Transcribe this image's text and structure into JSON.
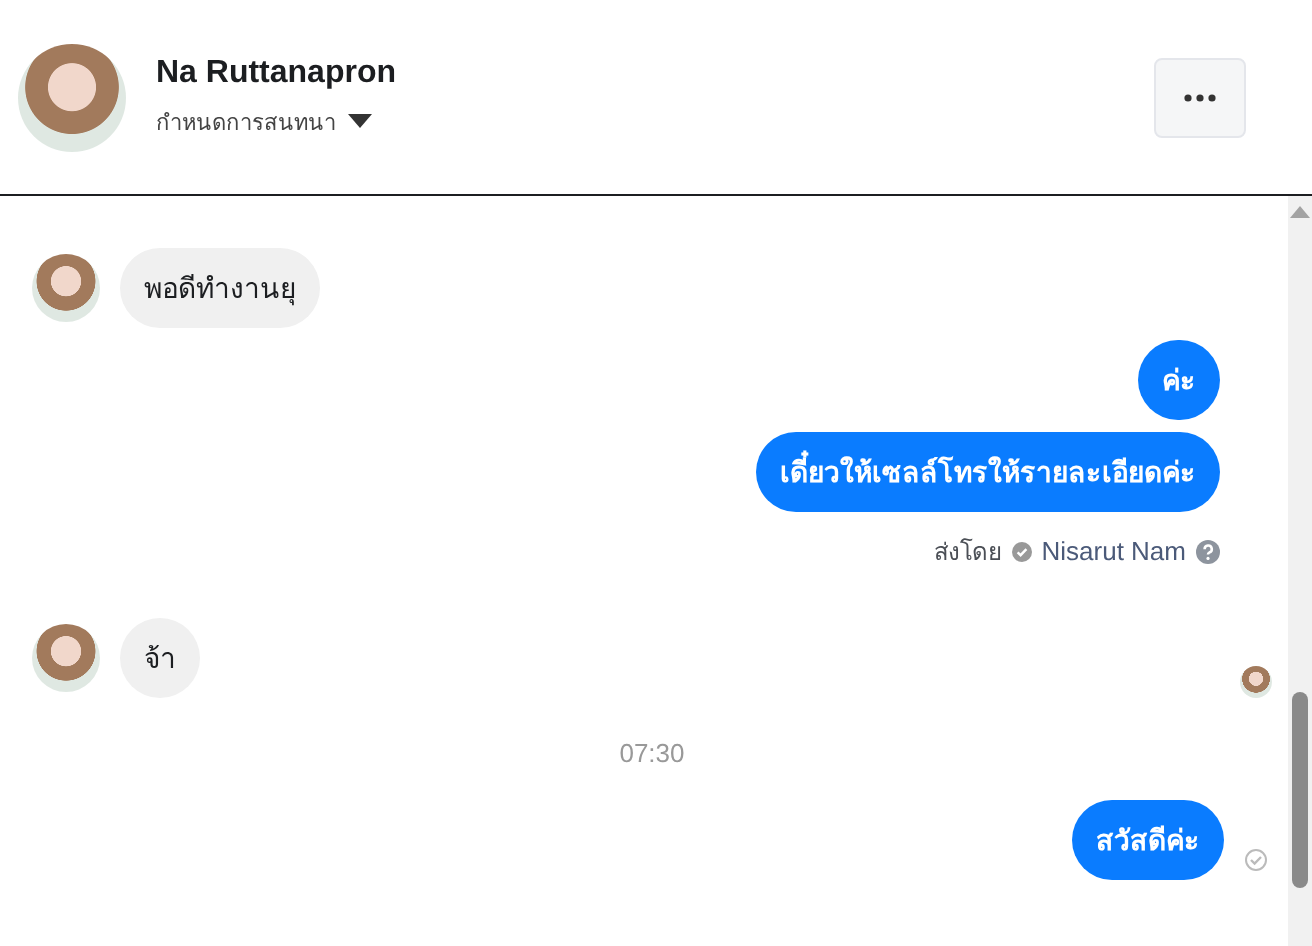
{
  "header": {
    "name": "Na Ruttanapron",
    "subtitle": "กำหนดการสนทนา"
  },
  "messages": [
    {
      "kind": "incoming",
      "text": "พอดีทำงานยุ",
      "avatar": true,
      "read_avatar": false
    },
    {
      "kind": "outgoing",
      "text": "ค่ะ",
      "delivered": false
    },
    {
      "kind": "outgoing",
      "text": "เดี๋ยวให้เซลล์โทรให้รายละเอียดค่ะ",
      "delivered": false
    },
    {
      "kind": "sent_by",
      "label": "ส่งโดย",
      "name": "Nisarut Nam"
    },
    {
      "kind": "incoming",
      "text": "จ้า",
      "avatar": true,
      "read_avatar": true
    },
    {
      "kind": "timestamp",
      "text": "07:30"
    },
    {
      "kind": "outgoing",
      "text": "สวัสดีค่ะ",
      "delivered": true
    }
  ]
}
